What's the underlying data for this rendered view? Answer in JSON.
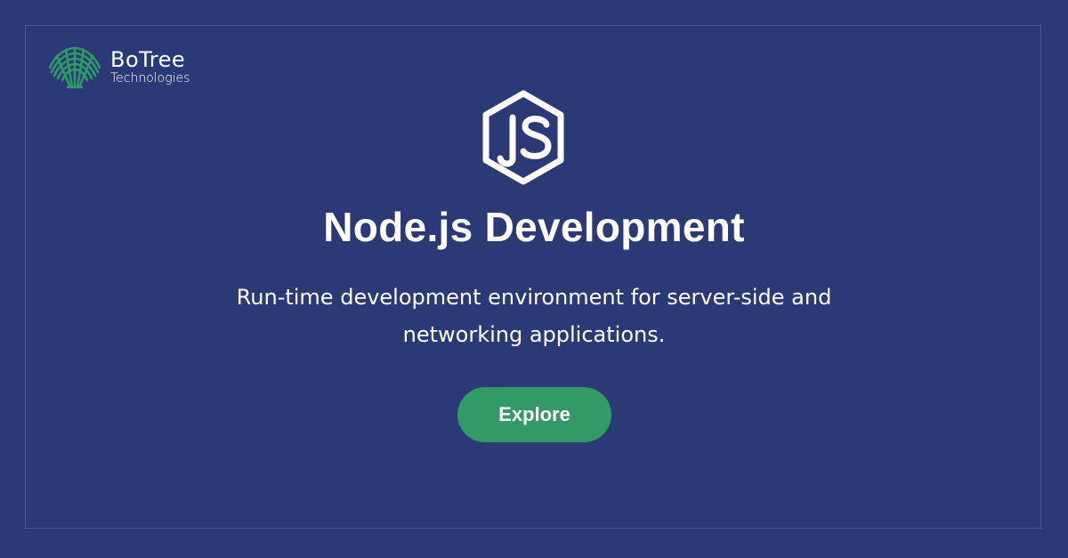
{
  "brand": {
    "name": "BoTree",
    "tagline": "Technologies",
    "logo_icon": "tree-logo-icon",
    "logo_color": "#2e9a66"
  },
  "hero": {
    "icon": "nodejs-hexagon-icon",
    "title": "Node.js Development",
    "description": "Run-time development environment for server-side and networking applications.",
    "cta_label": "Explore"
  },
  "colors": {
    "background": "#2b3977",
    "frame_border": "#4a5893",
    "button": "#339966",
    "text": "#ffffff"
  }
}
